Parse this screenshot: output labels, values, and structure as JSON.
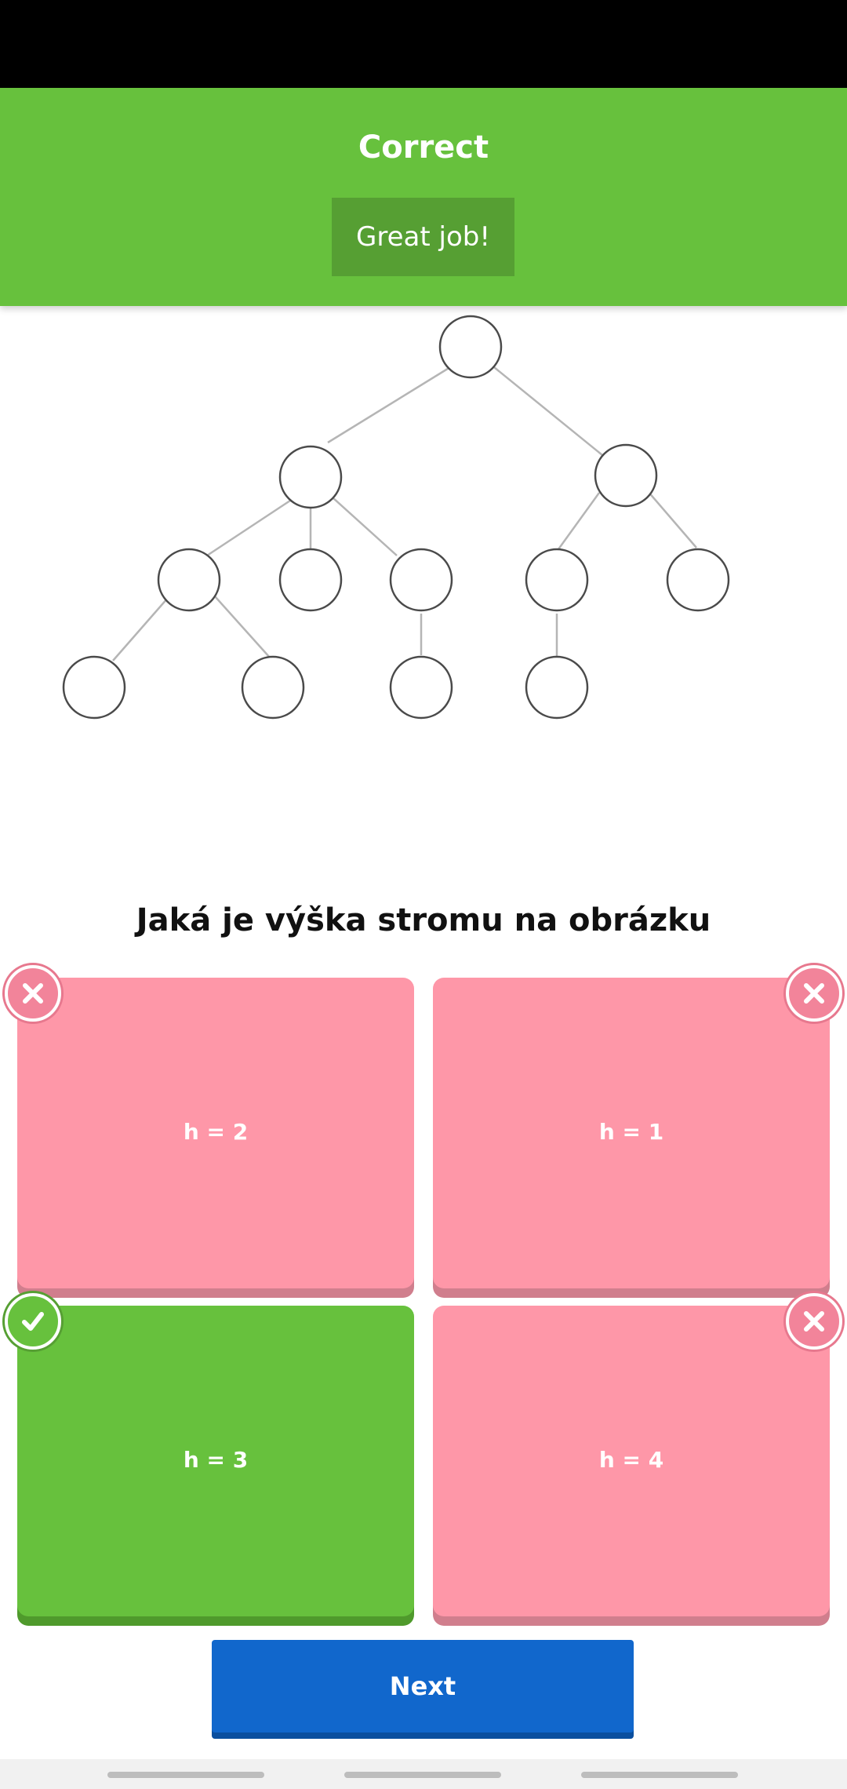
{
  "banner": {
    "title": "Correct",
    "badge_text": "Great job!",
    "color": "#67c13d"
  },
  "question": {
    "text": "Jaká je výška stromu na obrázku"
  },
  "answers": [
    {
      "label": "h = 2",
      "state": "wrong",
      "icon": "x-icon"
    },
    {
      "label": "h = 1",
      "state": "wrong",
      "icon": "x-icon"
    },
    {
      "label": "h = 3",
      "state": "correct",
      "icon": "check-icon"
    },
    {
      "label": "h = 4",
      "state": "wrong",
      "icon": "x-icon"
    }
  ],
  "next_button": {
    "label": "Next",
    "color": "#1167cc"
  },
  "colors": {
    "wrong": "#fe97a8",
    "correct": "#67c13d"
  }
}
